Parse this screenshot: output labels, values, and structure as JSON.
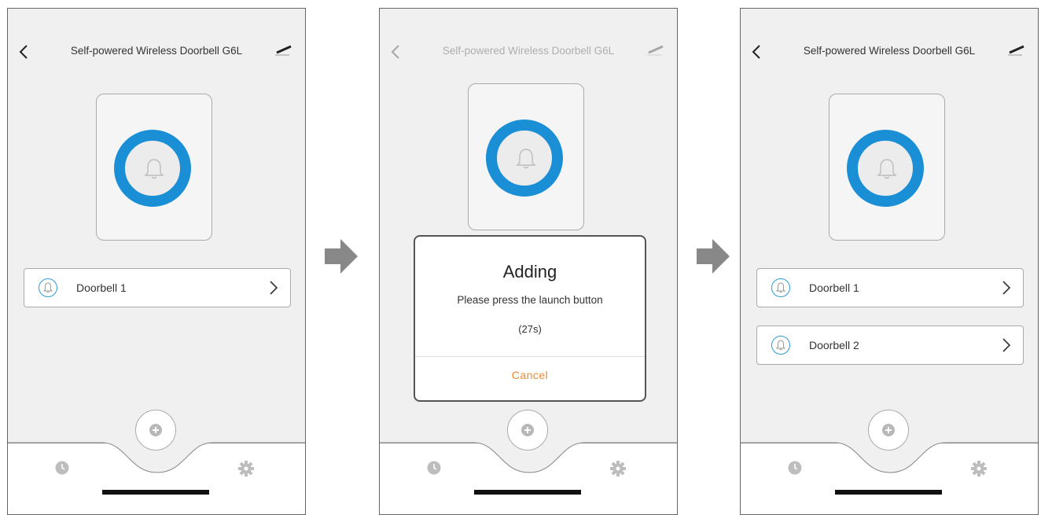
{
  "screens": [
    {
      "header": {
        "title": "Self-powered Wireless Doorbell G6L"
      },
      "devices": [
        {
          "label": "Doorbell 1"
        }
      ]
    },
    {
      "header": {
        "title": "Self-powered Wireless Doorbell G6L"
      },
      "dialog": {
        "title": "Adding",
        "message": "Please press the launch button",
        "countdown": "(27s)",
        "cancel_label": "Cancel"
      }
    },
    {
      "header": {
        "title": "Self-powered Wireless Doorbell G6L"
      },
      "devices": [
        {
          "label": "Doorbell 1"
        },
        {
          "label": "Doorbell 2"
        }
      ]
    }
  ],
  "icons": {
    "back": "chevron-left-icon",
    "edit": "pencil-icon",
    "bell": "bell-icon",
    "add": "plus-icon",
    "history": "clock-icon",
    "settings": "gear-icon",
    "step": "arrow-right-icon"
  },
  "colors": {
    "accent": "#1a8fd6",
    "cancel": "#f08a2c",
    "fab": "#b8b8b8"
  }
}
